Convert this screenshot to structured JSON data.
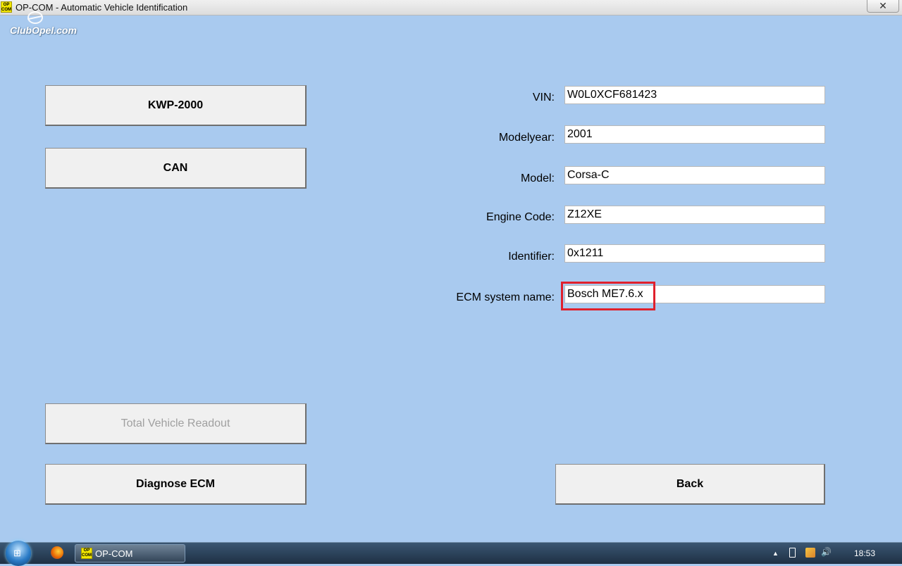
{
  "window": {
    "title": "OP-COM - Automatic Vehicle Identification",
    "icon_text": "OP COM",
    "close_label": "✕"
  },
  "watermark": {
    "text": "ClubOpel.com"
  },
  "left_buttons": {
    "kwp": "KWP-2000",
    "can": "CAN",
    "total_readout": "Total Vehicle Readout",
    "diagnose": "Diagnose ECM"
  },
  "fields": [
    {
      "label": "VIN:",
      "value": "W0L0XCF681423"
    },
    {
      "label": "Modelyear:",
      "value": "2001"
    },
    {
      "label": "Model:",
      "value": "Corsa-C"
    },
    {
      "label": "Engine Code:",
      "value": "Z12XE"
    },
    {
      "label": "Identifier:",
      "value": "0x1211"
    },
    {
      "label": "ECM system name:",
      "value": "Bosch ME7.6.x"
    }
  ],
  "back_button": "Back",
  "taskbar": {
    "app_label": "OP-COM",
    "app_icon_text": "OP COM",
    "tray_arrow": "▲",
    "tray_volume": "🔊",
    "clock": "18:53"
  },
  "colors": {
    "background": "#a9caef",
    "highlight": "#e0202c",
    "disabled_text": "#a0a0a0"
  }
}
